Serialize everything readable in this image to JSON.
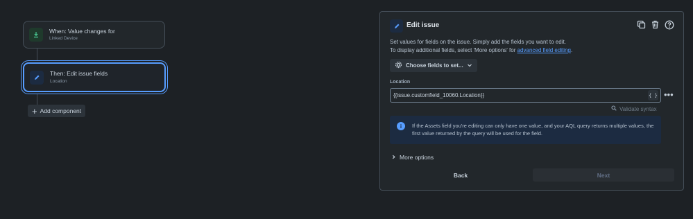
{
  "flow": {
    "trigger": {
      "title": "When: Value changes for",
      "subtitle": "Linked Device"
    },
    "action": {
      "title": "Then: Edit issue fields",
      "subtitle": "Location"
    },
    "add_component_label": "Add component"
  },
  "panel": {
    "title": "Edit issue",
    "desc_line1": "Set values for fields on the issue. Simply add the fields you want to edit.",
    "desc_line2_prefix": "To display additional fields, select 'More options' for ",
    "desc_link": "advanced field editing",
    "desc_line2_suffix": ".",
    "choose_fields_label": "Choose fields to set...",
    "field_label": "Location",
    "field_value": "{{issue.customfield_10060.Location}}",
    "brace_button": "{ }",
    "validate_label": "Validate syntax",
    "info_text": "If the Assets field you're editing can only have one value, and your AQL query returns multiple values, the first value returned by the query will be used for the field.",
    "more_options_label": "More options",
    "back_label": "Back",
    "next_label": "Next"
  },
  "colors": {
    "accent": "#579dff",
    "background": "#1d2125",
    "panel": "#22272b",
    "trigger_icon": "#1f3a2c"
  },
  "icons": {
    "trigger": "download-arrow-icon",
    "action": "pencil-icon",
    "tools": [
      "duplicate-icon",
      "trash-icon",
      "help-icon"
    ]
  }
}
